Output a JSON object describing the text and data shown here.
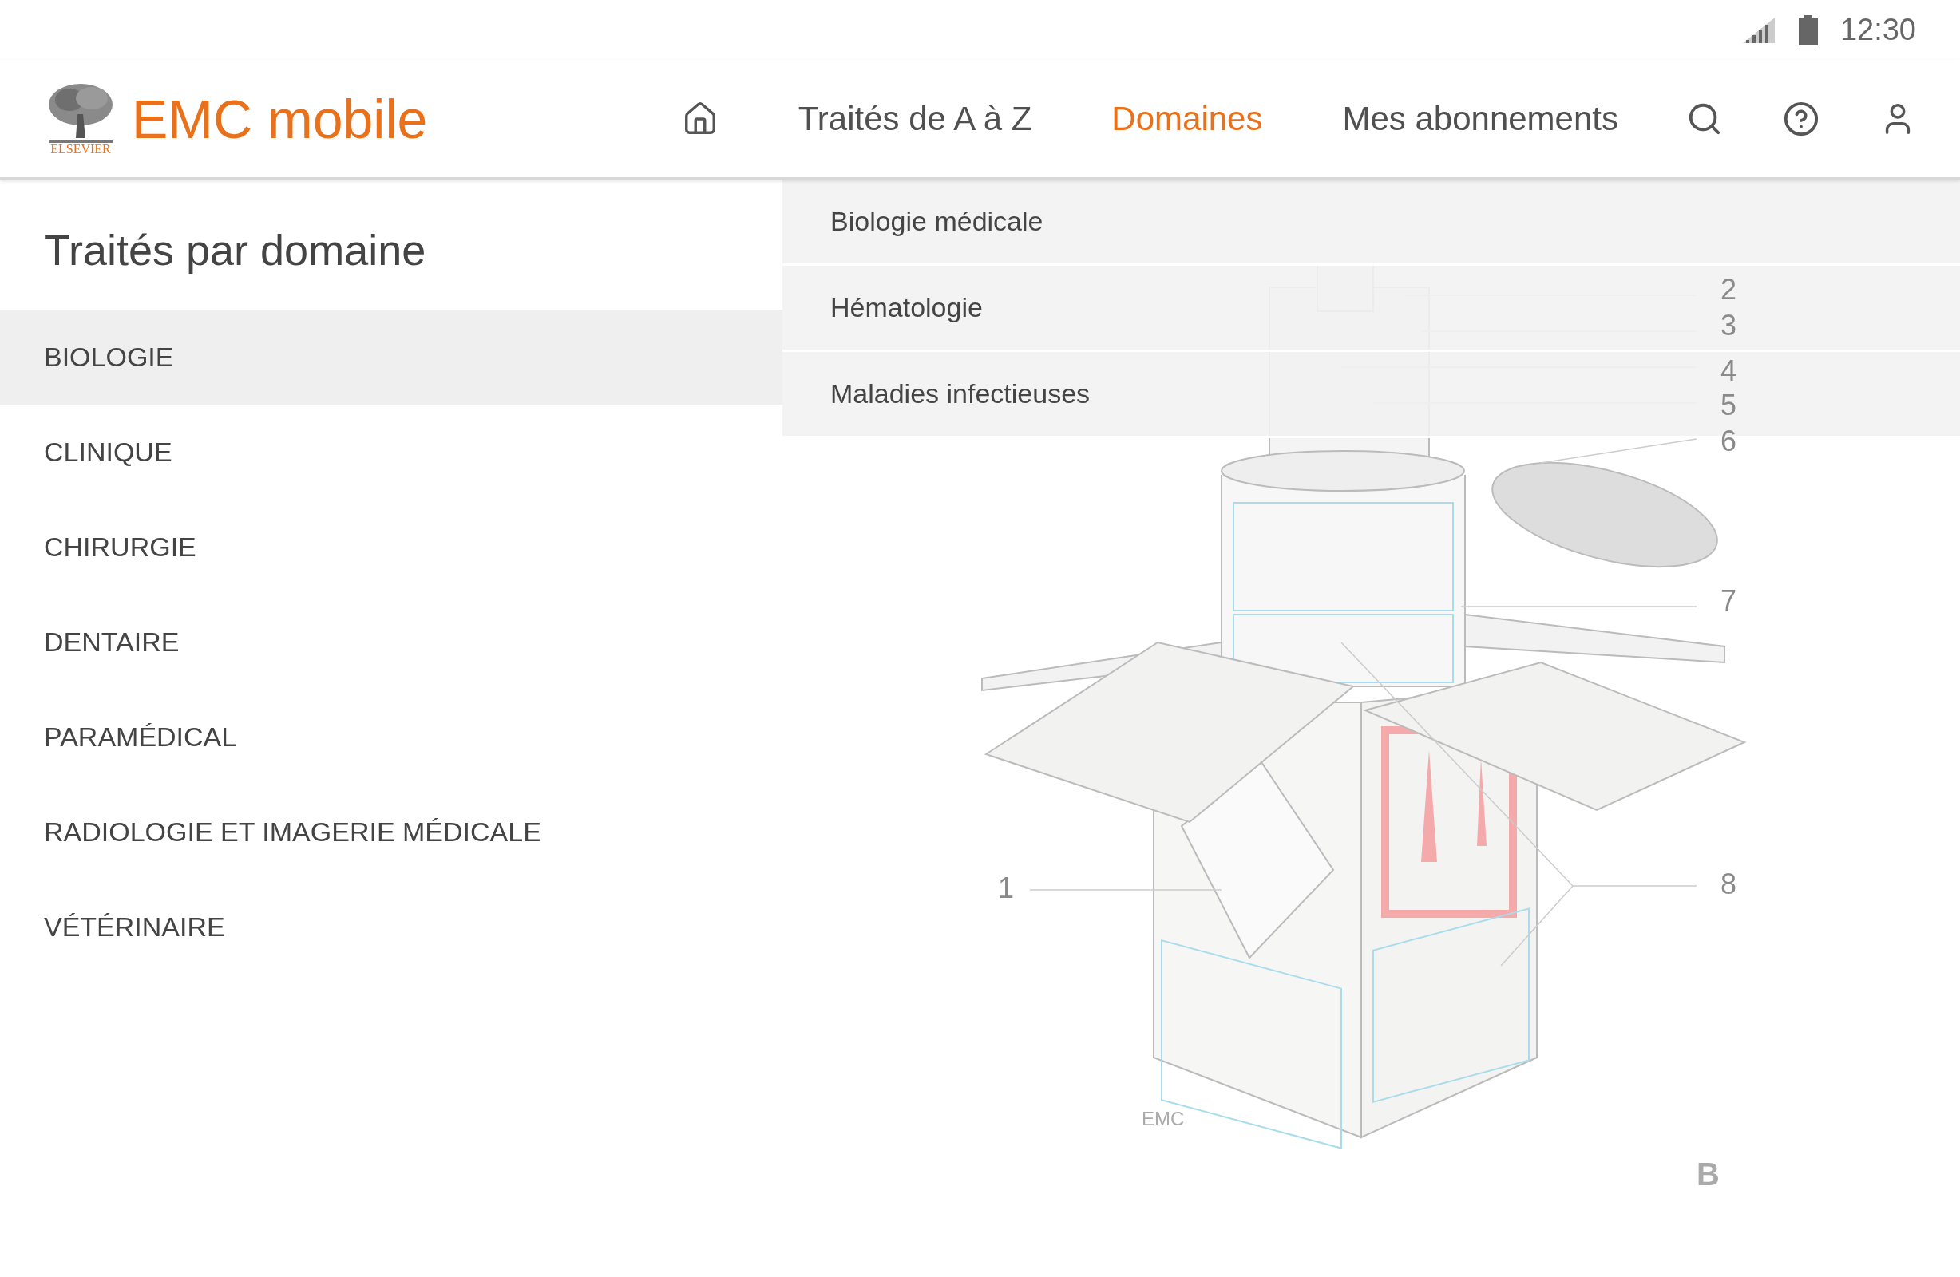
{
  "status_bar": {
    "time": "12:30"
  },
  "header": {
    "publisher": "ELSEVIER",
    "app_name": "EMC mobile",
    "nav": [
      {
        "kind": "home"
      },
      {
        "kind": "link",
        "label": "Traités de A à Z",
        "selected": false
      },
      {
        "kind": "link",
        "label": "Domaines",
        "selected": true
      },
      {
        "kind": "link",
        "label": "Mes abonnements",
        "selected": false
      },
      {
        "kind": "search"
      },
      {
        "kind": "help"
      },
      {
        "kind": "account"
      }
    ]
  },
  "sidebar": {
    "title": "Traités par domaine",
    "items": [
      {
        "label": "BIOLOGIE",
        "selected": true
      },
      {
        "label": "CLINIQUE",
        "selected": false
      },
      {
        "label": "CHIRURGIE",
        "selected": false
      },
      {
        "label": "DENTAIRE",
        "selected": false
      },
      {
        "label": "PARAMÉDICAL",
        "selected": false
      },
      {
        "label": "RADIOLOGIE ET IMAGERIE MÉDICALE",
        "selected": false
      },
      {
        "label": "VÉTÉRINAIRE",
        "selected": false
      }
    ]
  },
  "submenu": {
    "items": [
      "Biologie médicale",
      "Hématologie",
      "Maladies infectieuses"
    ]
  },
  "figure": {
    "labels": [
      "2",
      "3",
      "4",
      "5",
      "6",
      "7",
      "1",
      "8"
    ],
    "panel_letter": "B",
    "signature": "EMC"
  }
}
